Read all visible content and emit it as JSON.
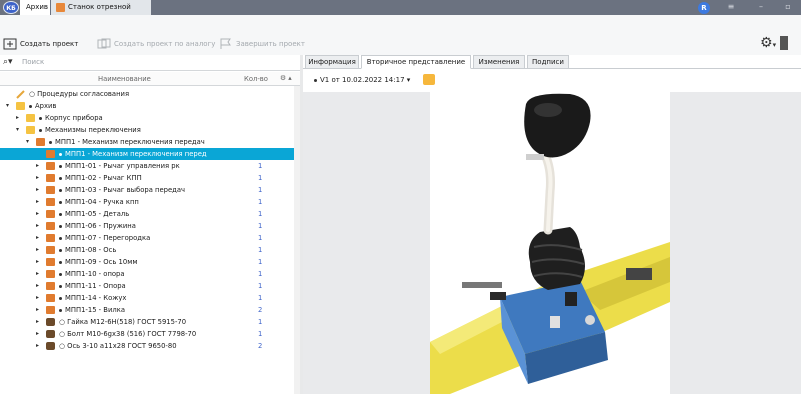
{
  "app": {
    "logo_text": "КБ",
    "tabs": [
      {
        "label": "Архив",
        "active": true
      },
      {
        "label": "Станок отрезной",
        "active": false
      }
    ],
    "user_initial": "R",
    "window_controls": [
      "≡",
      "–",
      "▫"
    ]
  },
  "toolbar": {
    "create_project": "Создать проект",
    "create_by_analog": "Создать проект по аналогу",
    "finish_project": "Завершить проект"
  },
  "search": {
    "placeholder": "Поиск"
  },
  "tree_header": {
    "name": "Наименование",
    "qty": "Кол-во"
  },
  "tree": [
    {
      "label": "Процедуры согласования",
      "level": 0,
      "icon": "approval-icon",
      "expand": "",
      "qty": "",
      "dot": false
    },
    {
      "label": "Архив",
      "level": 0,
      "icon": "folder-icon",
      "expand": "▾",
      "qty": "",
      "dot": true
    },
    {
      "label": "Корпус прибора",
      "level": 1,
      "icon": "folder-icon",
      "expand": "▸",
      "qty": "",
      "dot": true
    },
    {
      "label": "Механизмы переключения",
      "level": 1,
      "icon": "folder-icon",
      "expand": "▾",
      "qty": "",
      "dot": true
    },
    {
      "label": "МПП1 - Механизм переключения передач",
      "level": 2,
      "icon": "assembly-icon",
      "expand": "▾",
      "qty": "",
      "dot": true
    },
    {
      "label": "МПП1 - Механизм переключения перед",
      "level": 3,
      "icon": "assembly-icon",
      "expand": "",
      "qty": "",
      "dot": true,
      "selected": true
    },
    {
      "label": "МПП1-01 - Рычаг управления рк",
      "level": 3,
      "icon": "part-icon",
      "expand": "▸",
      "qty": "1",
      "dot": true
    },
    {
      "label": "МПП1-02 - Рычаг КПП",
      "level": 3,
      "icon": "part-icon",
      "expand": "▸",
      "qty": "1",
      "dot": true
    },
    {
      "label": "МПП1-03 - Рычаг выбора передач",
      "level": 3,
      "icon": "part-icon",
      "expand": "▸",
      "qty": "1",
      "dot": true
    },
    {
      "label": "МПП1-04 - Ручка кпп",
      "level": 3,
      "icon": "part-icon",
      "expand": "▸",
      "qty": "1",
      "dot": true
    },
    {
      "label": "МПП1-05 - Деталь",
      "level": 3,
      "icon": "part-icon",
      "expand": "▸",
      "qty": "1",
      "dot": true
    },
    {
      "label": "МПП1-06 - Пружина",
      "level": 3,
      "icon": "part-icon",
      "expand": "▸",
      "qty": "1",
      "dot": true
    },
    {
      "label": "МПП1-07 - Перегородка",
      "level": 3,
      "icon": "part-icon",
      "expand": "▸",
      "qty": "1",
      "dot": true
    },
    {
      "label": "МПП1-08 - Ось",
      "level": 3,
      "icon": "part-icon",
      "expand": "▸",
      "qty": "1",
      "dot": true
    },
    {
      "label": "МПП1-09 - Ось 10мм",
      "level": 3,
      "icon": "part-icon",
      "expand": "▸",
      "qty": "1",
      "dot": true
    },
    {
      "label": "МПП1-10 - опора",
      "level": 3,
      "icon": "part-icon",
      "expand": "▸",
      "qty": "1",
      "dot": true
    },
    {
      "label": "МПП1-11 - Опора",
      "level": 3,
      "icon": "part-icon",
      "expand": "▸",
      "qty": "1",
      "dot": true
    },
    {
      "label": "МПП1-14 - Кожух",
      "level": 3,
      "icon": "part-icon",
      "expand": "▸",
      "qty": "1",
      "dot": true
    },
    {
      "label": "МПП1-15 - Вилка",
      "level": 3,
      "icon": "part-icon",
      "expand": "▸",
      "qty": "2",
      "dot": true
    },
    {
      "label": "Гайка М12-6H(518) ГОСТ 5915-70",
      "level": 3,
      "icon": "standard-part-icon",
      "expand": "▸",
      "qty": "1",
      "dot": false
    },
    {
      "label": "Болт М10-6gx38 (516) ГОСТ 7798-70",
      "level": 3,
      "icon": "standard-part-icon",
      "expand": "▸",
      "qty": "1",
      "dot": false
    },
    {
      "label": "Ось 3-10 a11x28 ГОСТ 9650-80",
      "level": 3,
      "icon": "standard-part-icon",
      "expand": "▸",
      "qty": "2",
      "dot": false
    }
  ],
  "tabs": [
    {
      "label": "Информация"
    },
    {
      "label": "Вторичное представление",
      "active": true
    },
    {
      "label": "Изменения"
    },
    {
      "label": "Подписи"
    }
  ],
  "version": {
    "label": "V1 от 10.02.2022 14:17"
  },
  "colors": {
    "selection": "#0aa6d6",
    "model_yellow": "#f0e14a",
    "model_blue": "#4a86c8",
    "model_black": "#1c1c1c"
  }
}
